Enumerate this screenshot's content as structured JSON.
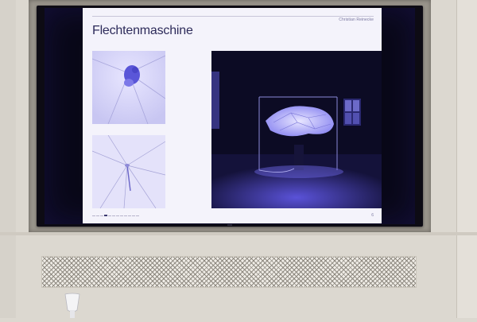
{
  "slide": {
    "author": "Christian Reinecke",
    "title": "Flechtenmaschine",
    "page_number": "6"
  },
  "pager": {
    "total": 12,
    "current": 4
  },
  "images": [
    {
      "name": "photo-flower-closeup",
      "icon": "photo"
    },
    {
      "name": "photo-membrane-detail",
      "icon": "photo"
    },
    {
      "name": "photo-installation-night",
      "icon": "photo"
    }
  ],
  "colors": {
    "slide_bg": "#f4f3fb",
    "title": "#2d2b5a",
    "installation_glow": "#b9b7ff",
    "wall": "#dcd8d0"
  }
}
